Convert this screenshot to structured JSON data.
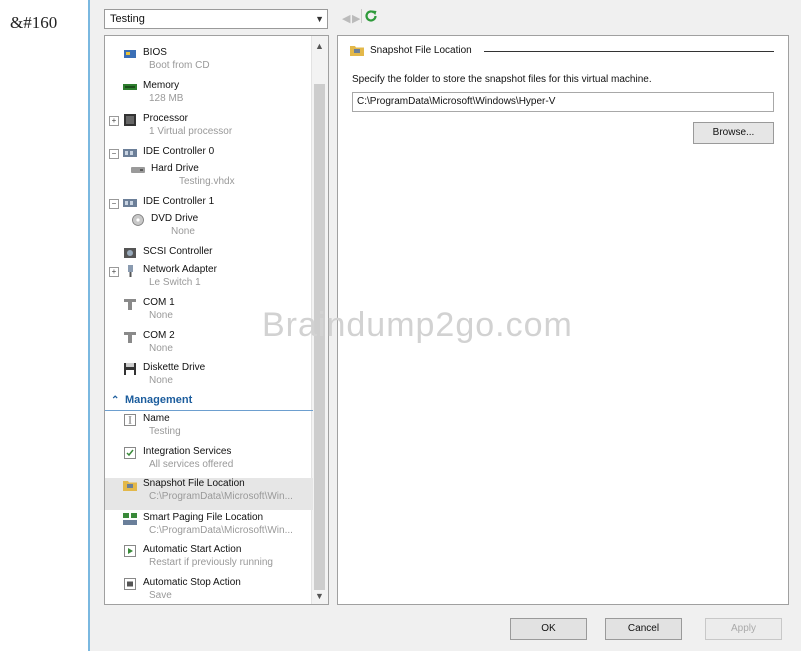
{
  "stray_text": "&#160",
  "header": {
    "vm_select": "Testing",
    "back_icon": "◀",
    "forward_icon": "▶"
  },
  "tree": {
    "hardware_items": [
      {
        "icon": "bios-icon",
        "name": "BIOS",
        "sub": "Boot from CD"
      },
      {
        "icon": "memory-icon",
        "name": "Memory",
        "sub": "128 MB"
      },
      {
        "icon": "processor-icon",
        "name": "Processor",
        "sub": "1 Virtual processor",
        "expander": "+"
      },
      {
        "icon": "controller-icon",
        "name": "IDE Controller 0",
        "sub": "",
        "expander": "−"
      },
      {
        "icon": "hard-drive-icon",
        "name": "Hard Drive",
        "sub": "Testing.vhdx"
      },
      {
        "icon": "controller-icon",
        "name": "IDE Controller 1",
        "sub": "",
        "expander": "−"
      },
      {
        "icon": "dvd-drive-icon",
        "name": "DVD Drive",
        "sub": "None"
      },
      {
        "icon": "scsi-controller-icon",
        "name": "SCSI Controller",
        "sub": ""
      },
      {
        "icon": "network-adapter-icon",
        "name": "Network Adapter",
        "sub": "Le Switch 1",
        "expander": "+"
      },
      {
        "icon": "com-port-icon",
        "name": "COM 1",
        "sub": "None"
      },
      {
        "icon": "com-port-icon",
        "name": "COM 2",
        "sub": "None"
      },
      {
        "icon": "diskette-drive-icon",
        "name": "Diskette Drive",
        "sub": "None"
      }
    ],
    "management_header": "Management",
    "management_items": [
      {
        "icon": "name-icon",
        "name": "Name",
        "sub": "Testing"
      },
      {
        "icon": "integration-services-icon",
        "name": "Integration Services",
        "sub": "All services offered"
      },
      {
        "icon": "snapshot-folder-icon",
        "name": "Snapshot File Location",
        "sub": "C:\\ProgramData\\Microsoft\\Win...",
        "selected": true
      },
      {
        "icon": "smart-paging-icon",
        "name": "Smart Paging File Location",
        "sub": "C:\\ProgramData\\Microsoft\\Win..."
      },
      {
        "icon": "start-action-icon",
        "name": "Automatic Start Action",
        "sub": "Restart if previously running"
      },
      {
        "icon": "stop-action-icon",
        "name": "Automatic Stop Action",
        "sub": "Save"
      }
    ]
  },
  "panel": {
    "title": "Snapshot File Location",
    "description": "Specify the folder to store the snapshot files for this virtual machine.",
    "path": "C:\\ProgramData\\Microsoft\\Windows\\Hyper-V",
    "browse": "Browse..."
  },
  "footer": {
    "ok": "OK",
    "cancel": "Cancel",
    "apply": "Apply"
  },
  "watermark": "Braindump2go.com",
  "colors": {
    "section": "#1c5d9d",
    "frame_border": "#7ab8e0",
    "selected_bg": "#e6e6e6"
  }
}
